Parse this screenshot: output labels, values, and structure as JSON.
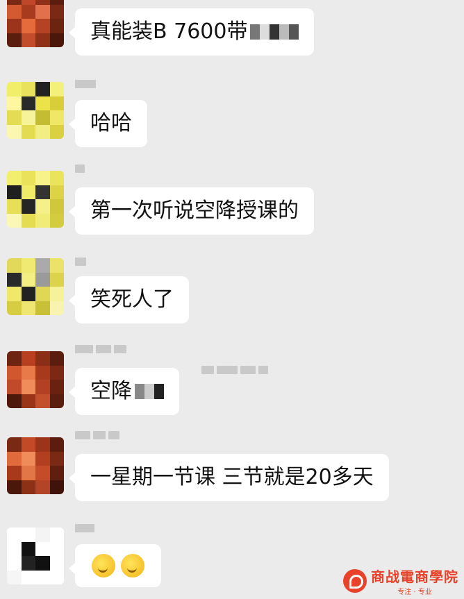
{
  "messages": [
    {
      "text": "真能装B 7600带",
      "censored": true
    },
    {
      "text": "哈哈",
      "censored": false
    },
    {
      "text": "第一次听说空降授课的",
      "censored": false
    },
    {
      "text": "笑死人了",
      "censored": false
    },
    {
      "text": "空降",
      "censored": true
    },
    {
      "text": "一星期一节课 三节就是20多天",
      "censored": false
    },
    {
      "text": "",
      "emojis": [
        "smirk-emoji",
        "smirk-emoji"
      ],
      "censored": false
    }
  ],
  "watermark": {
    "title": "商战電商學院",
    "subtitle": "专注 · 专业",
    "brand_color": "#e8432a"
  },
  "colors": {
    "background": "#ebebeb",
    "bubble": "#ffffff",
    "text": "#111111"
  }
}
